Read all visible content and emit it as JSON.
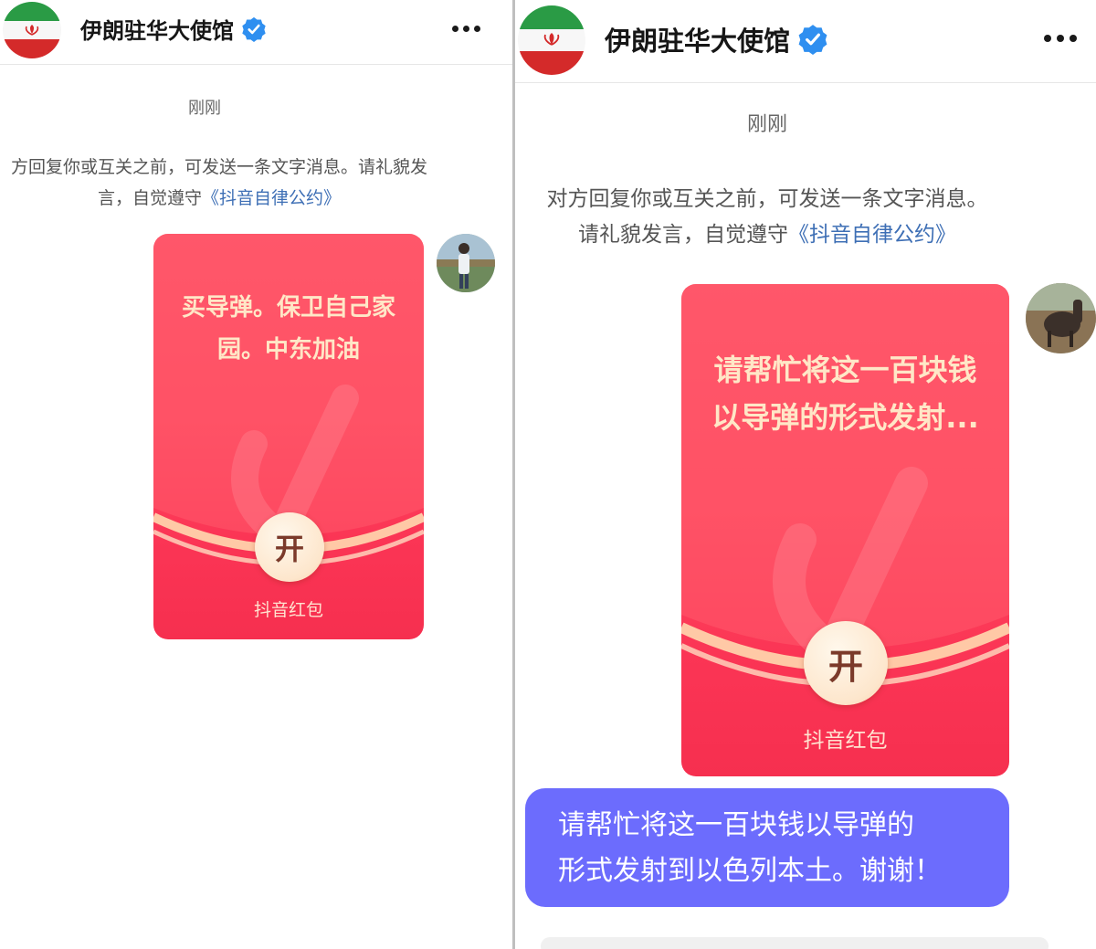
{
  "left": {
    "header": {
      "title": "伊朗驻华大使馆"
    },
    "time": "刚刚",
    "notice": {
      "line1": "方回复你或互关之前，可发送一条文字消息。请礼貌发",
      "line2_prefix": "言，自觉遵守",
      "link": "《抖音自律公约》"
    },
    "envelope": {
      "line1": "买导弹。保卫自己家",
      "line2": "园。中东加油",
      "open_label": "开",
      "brand": "抖音红包"
    }
  },
  "right": {
    "header": {
      "title": "伊朗驻华大使馆"
    },
    "time": "刚刚",
    "notice": {
      "line1": "对方回复你或互关之前，可发送一条文字消息。",
      "line2_prefix": "请礼貌发言，自觉遵守",
      "link": "《抖音自律公约》"
    },
    "envelope": {
      "line1": "请帮忙将这一百块钱",
      "line2": "以导弹的形式发射...",
      "open_label": "开",
      "brand": "抖音红包"
    },
    "message": {
      "line1": "请帮忙将这一百块钱以导弹的",
      "line2": "形式发射到以色列本土。谢谢！"
    }
  },
  "colors": {
    "envelope": "#fe4a5f",
    "bubble": "#6c6cfd",
    "verified": "#2f8ff0",
    "link": "#3e6fb5"
  },
  "icons": [
    "iran-flag-avatar",
    "verified-badge-icon",
    "more-options-icon",
    "user-avatar"
  ]
}
